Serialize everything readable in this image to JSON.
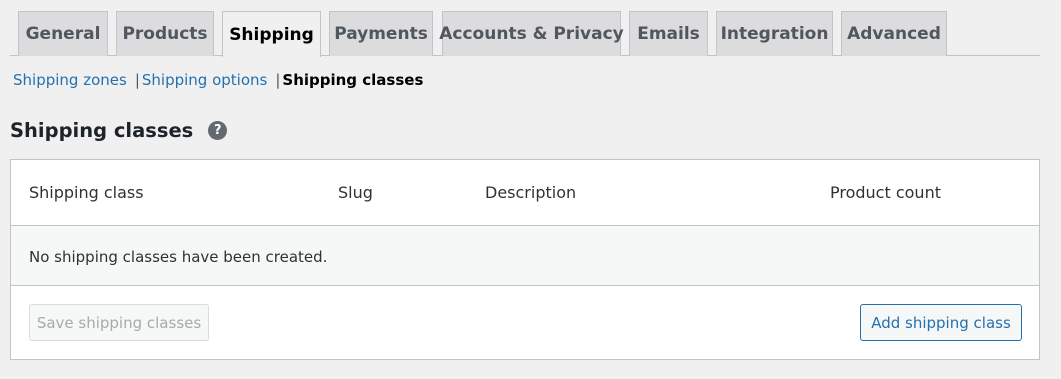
{
  "tabs": [
    {
      "label": "General",
      "active": false
    },
    {
      "label": "Products",
      "active": false
    },
    {
      "label": "Shipping",
      "active": true
    },
    {
      "label": "Payments",
      "active": false
    },
    {
      "label": "Accounts & Privacy",
      "active": false
    },
    {
      "label": "Emails",
      "active": false
    },
    {
      "label": "Integration",
      "active": false
    },
    {
      "label": "Advanced",
      "active": false
    }
  ],
  "subnav": {
    "items": [
      {
        "label": "Shipping zones"
      },
      {
        "label": "Shipping options"
      },
      {
        "label": "Shipping classes"
      }
    ],
    "separator": "|"
  },
  "page": {
    "title": "Shipping classes",
    "help_icon": "?"
  },
  "table": {
    "columns": [
      "Shipping class",
      "Slug",
      "Description",
      "Product count"
    ],
    "empty_message": "No shipping classes have been created."
  },
  "actions": {
    "save_label": "Save shipping classes",
    "add_label": "Add shipping class"
  },
  "colors": {
    "link": "#2271b1",
    "background": "#f0f0f1",
    "border": "#c3c4c7",
    "tab_inactive": "#dcdcde"
  }
}
